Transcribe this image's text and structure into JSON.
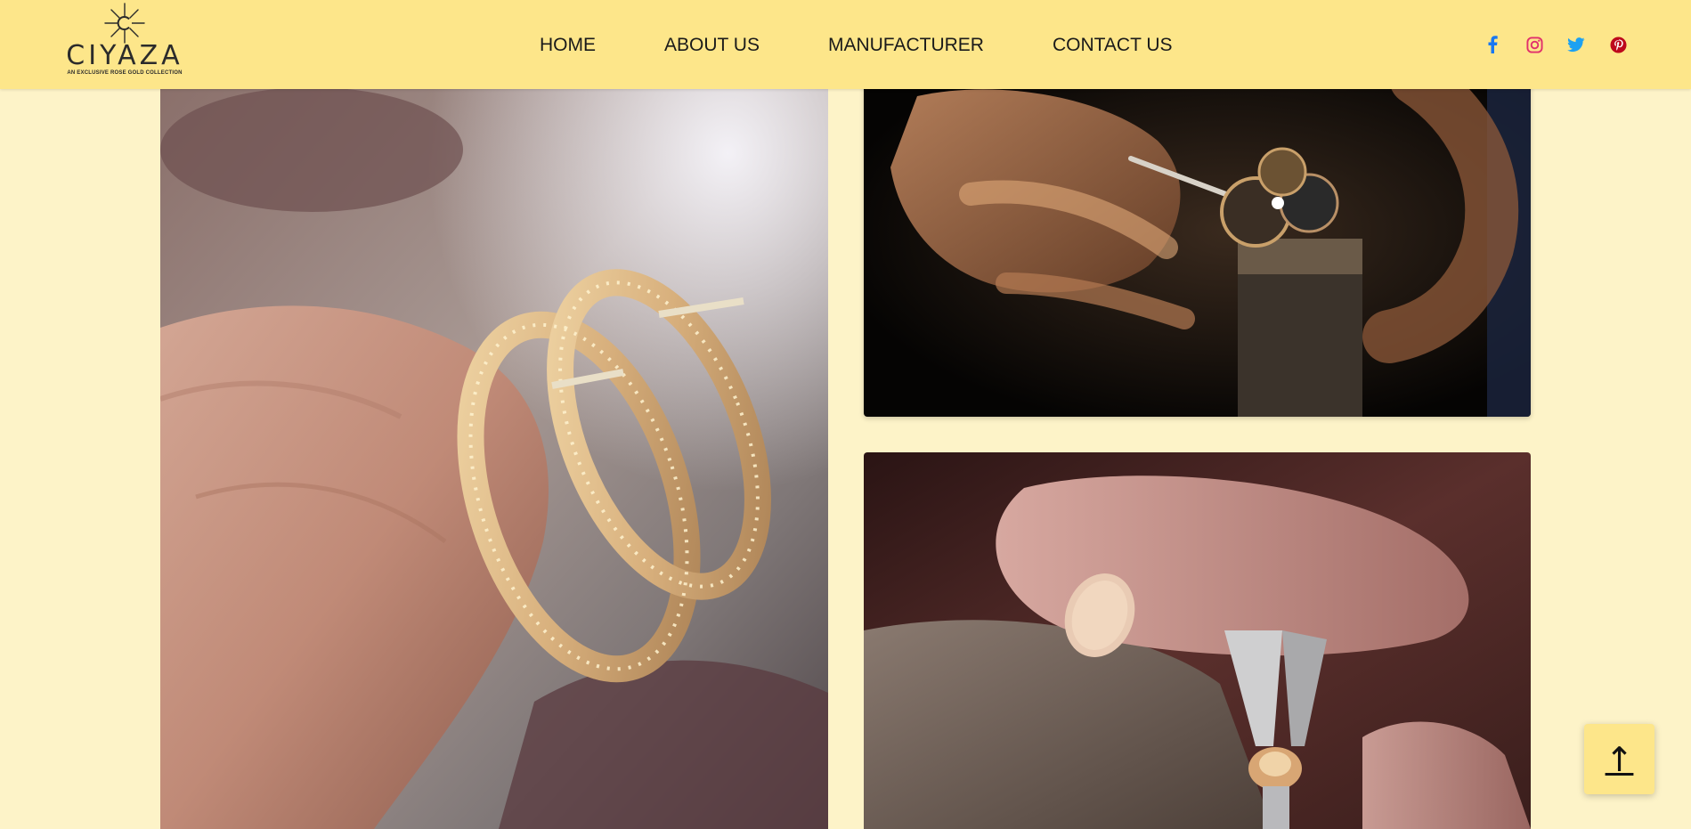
{
  "header": {
    "logo": {
      "brand": "CIYAZA",
      "tagline": "AN EXCLUSIVE ROSE GOLD COLLECTION"
    },
    "nav": [
      {
        "label": "HOME"
      },
      {
        "label": "ABOUT US"
      },
      {
        "label": "MANUFACTURER"
      },
      {
        "label": "CONTACT US"
      }
    ],
    "social": [
      {
        "icon": "facebook-icon",
        "color": "#1877f2"
      },
      {
        "icon": "instagram-icon",
        "color": "#e1306c"
      },
      {
        "icon": "twitter-icon",
        "color": "#1da1f2"
      },
      {
        "icon": "pinterest-icon",
        "color": "#bd081c"
      }
    ]
  },
  "gallery": [
    {
      "icon": "rose-gold-ear-cuff-photo"
    },
    {
      "icon": "jeweler-setting-brooch-photo"
    },
    {
      "icon": "jeweler-setting-ring-photo"
    }
  ],
  "back_to_top": {
    "label": "↑"
  },
  "colors": {
    "header_bg": "#fde68a",
    "page_bg": "#fdf3c8",
    "text": "#1a1a1a"
  }
}
